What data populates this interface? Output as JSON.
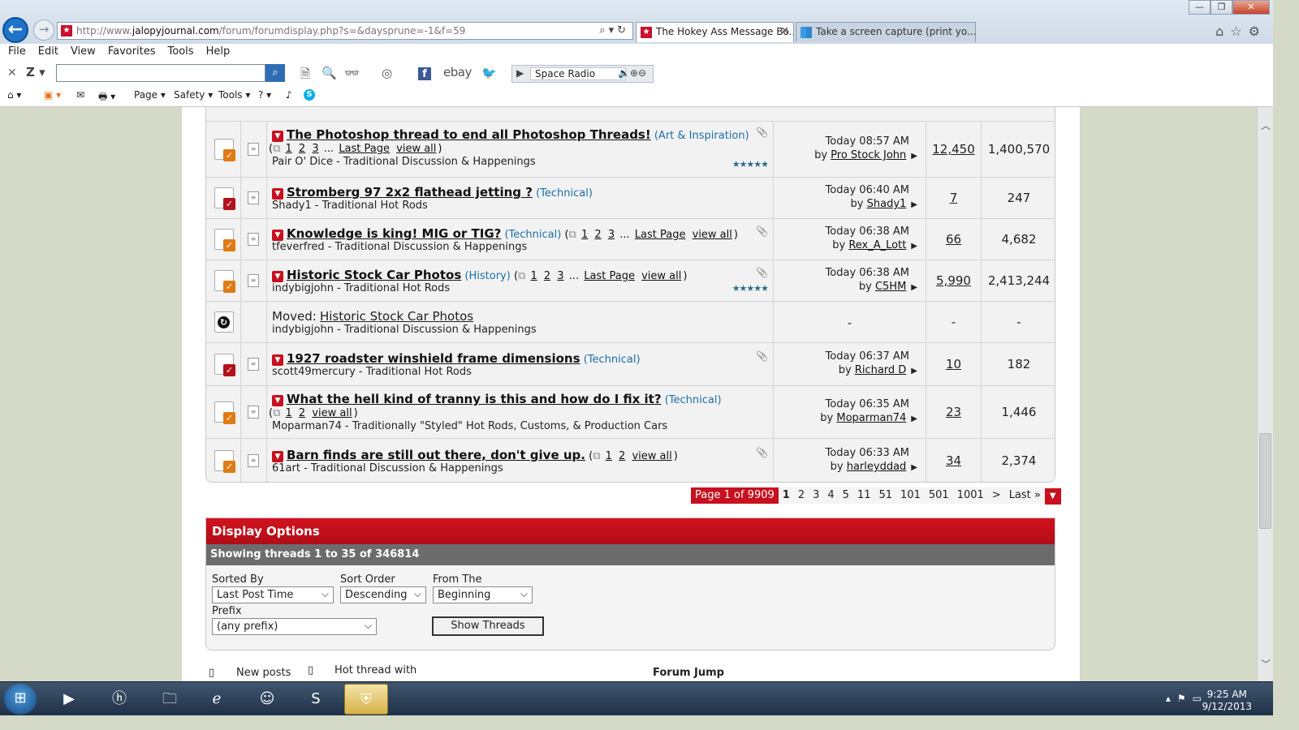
{
  "browser": {
    "url_prefix": "http://www.",
    "url_domain": "jalopyjournal.com",
    "url_path": "/forum/forumdisplay.php?s=&daysprune=-1&f=59",
    "tabs": [
      {
        "label": "The Hokey Ass Message Bo...",
        "active": true
      },
      {
        "label": "Take a screen capture (print yo...",
        "active": false
      }
    ]
  },
  "menu": [
    "File",
    "Edit",
    "View",
    "Favorites",
    "Tools",
    "Help"
  ],
  "toolbar": {
    "ebay": "ebay",
    "radio_station": "Space Radio",
    "fb": "f",
    "favbar": [
      "Page",
      "Safety",
      "Tools"
    ]
  },
  "threads": [
    {
      "title": "The Photoshop thread to end all Photoshop Threads!",
      "prefix": "(Art & Inspiration)",
      "pages": [
        "1",
        "2",
        "3"
      ],
      "ellipsis": "...",
      "last_page": "Last Page",
      "view_all": "view all",
      "author_line": "Pair O' Dice - Traditional Discussion & Happenings",
      "last_post_time": "Today 08:57 AM",
      "by_prefix": "by",
      "last_poster": "Pro Stock John",
      "replies": "12,450",
      "views": "1,400,570",
      "status": "orange",
      "attachment": true,
      "rating": 5
    },
    {
      "title": "Stromberg 97 2x2 flathead jetting ?",
      "prefix": "(Technical)",
      "author_line": "Shady1 - Traditional Hot Rods",
      "last_post_time": "Today 06:40 AM",
      "by_prefix": "by",
      "last_poster": "Shady1",
      "replies": "7",
      "views": "247",
      "status": "red"
    },
    {
      "title": "Knowledge is king! MIG or TIG?",
      "prefix": "(Technical)",
      "pages": [
        "1",
        "2",
        "3"
      ],
      "ellipsis": "...",
      "last_page": "Last Page",
      "view_all": "view all",
      "author_line": "tfeverfred - Traditional Discussion & Happenings",
      "last_post_time": "Today 06:38 AM",
      "by_prefix": "by",
      "last_poster": "Rex_A_Lott",
      "replies": "66",
      "views": "4,682",
      "status": "orange",
      "attachment": true
    },
    {
      "title": "Historic Stock Car Photos",
      "prefix": "(History)",
      "pages": [
        "1",
        "2",
        "3"
      ],
      "ellipsis": "...",
      "last_page": "Last Page",
      "view_all": "view all",
      "author_line": "indybigjohn - Traditional Hot Rods",
      "last_post_time": "Today 06:38 AM",
      "by_prefix": "by",
      "last_poster": "C5HM",
      "replies": "5,990",
      "views": "2,413,244",
      "status": "orange",
      "attachment": true,
      "rating": 5
    },
    {
      "moved_label": "Moved:",
      "title": "Historic Stock Car Photos",
      "author_line": "indybigjohn - Traditional Discussion & Happenings",
      "last_post_time": "-",
      "replies": "-",
      "views": "-",
      "status": "moved"
    },
    {
      "title": "1927 roadster winshield frame dimensions",
      "prefix": "(Technical)",
      "author_line": "scott49mercury - Traditional Hot Rods",
      "last_post_time": "Today 06:37 AM",
      "by_prefix": "by",
      "last_poster": "Richard D",
      "replies": "10",
      "views": "182",
      "status": "red",
      "attachment": true
    },
    {
      "title": "What the hell kind of tranny is this and how do I fix it?",
      "prefix": "(Technical)",
      "pages": [
        "1",
        "2"
      ],
      "view_all": "view all",
      "author_line": "Moparman74 - Traditionally \"Styled\" Hot Rods, Customs, & Production Cars",
      "last_post_time": "Today 06:35 AM",
      "by_prefix": "by",
      "last_poster": "Moparman74",
      "replies": "23",
      "views": "1,446",
      "status": "orange"
    },
    {
      "title": "Barn finds are still out there, don't give up.",
      "prefix": "",
      "pages": [
        "1",
        "2"
      ],
      "view_all": "view all",
      "author_line": "61art - Traditional Discussion & Happenings",
      "last_post_time": "Today 06:33 AM",
      "by_prefix": "by",
      "last_poster": "harleyddad",
      "replies": "34",
      "views": "2,374",
      "status": "orange",
      "attachment": true
    }
  ],
  "pagination": {
    "current": "Page 1 of 9909",
    "pages": [
      "1",
      "2",
      "3",
      "4",
      "5",
      "11",
      "51",
      "101",
      "501",
      "1001"
    ],
    "next": ">",
    "last": "Last »"
  },
  "display_options": {
    "heading": "Display Options",
    "showing": "Showing threads 1 to 35 of 346814",
    "sorted_by_label": "Sorted By",
    "sorted_by_value": "Last Post Time",
    "sort_order_label": "Sort Order",
    "sort_order_value": "Descending",
    "from_the_label": "From The",
    "from_the_value": "Beginning",
    "prefix_label": "Prefix",
    "prefix_value": "(any prefix)",
    "show_button": "Show Threads"
  },
  "footer": {
    "legend_new": "New posts",
    "legend_hot": "Hot thread with",
    "forum_jump": "Forum Jump"
  },
  "taskbar": {
    "time": "9:25 AM",
    "date": "9/12/2013"
  },
  "colors": {
    "accent_red": "#c8101e",
    "prefix_blue": "#1b6ea8",
    "desktop_bg": "#d4d9c8"
  }
}
